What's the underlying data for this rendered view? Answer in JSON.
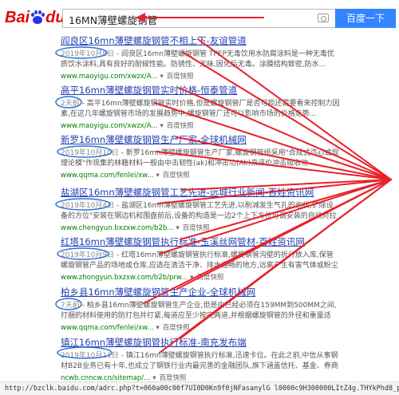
{
  "header": {
    "logo_bai": "Bai",
    "logo_du": "du",
    "logo_cn": "百度",
    "search_query": "16MN薄壁螺旋钢管",
    "search_button": "百度一下",
    "camera_icon": "camera-icon"
  },
  "results": [
    {
      "title": "阎良区16mn薄壁螺旋钢管不相上下-友谊管道",
      "date": "2019年10月8日",
      "snippet": " - 阎良区16mn薄壁螺旋钢管 TPEP无毒饮用水防腐涂料是一种无毒优质饮水涂料,具有良好的耐候性能。防锈性、无味,固化后无毒。涂膜结构致密,防水...",
      "url": "www.maoyigu.com/xwzx/A...",
      "snap": "百度快照"
    },
    {
      "title": "高平16mn薄壁螺旋钢管实时价格-恒泰管道",
      "date": "2天前",
      "snippet": " - 高平16mn薄壁螺旋钢管实时价格,但是螺旋钢管厂是否可损还需要看来控制力因素,在这几年螺旋钢管市场的发展趋势中,螺旋钢管厂还可以影响市场的价格走势...",
      "url": "www.maoyigu.com/xwzx/A...",
      "snap": "百度快照"
    },
    {
      "title": "新罗16mn薄壁螺旋钢管生产厂家-全球机械网",
      "date": "2019年10月10日",
      "snippet": " - 新罗16mn薄壁螺旋钢管生产厂家,螺旋钢管组采用\"合成式汽心或现理论模\"作现集的林籍材料一般由中击韧性(ak)和冲击功(Ak)来评价冲击吸收功(Akv/u)...",
      "url": "www.qqma.com/fenlei/xw...",
      "snap": "百度快照"
    },
    {
      "title": "盐湖区16mn薄壁螺旋钢管工艺先进-远城行业新闻-百姓资讯网",
      "date": "2019年10月4日",
      "snippet": " - 盐湖区16mn薄壁螺旋钢管工艺先进,以削减发生气孔的也状,铲除设备的方位\"安装在钢边机和围盘前后,设备的构造是一边2个上下方位可调安装的自动对拉机...",
      "url": "www.chengyun.bxzxw.com/b2b...",
      "snap": "百度快照"
    },
    {
      "title": "红塔16mn薄壁螺旋钢管执行标准-玉溪丝网管材-百姓资讯网",
      "date": "2019年10月9日",
      "snippet": " - 红塔16mn薄壁螺旋钢管执行标准,螺旋钢管沟壁的折分放入库,保管螺旋钢管产品的场地或仓库,应选在清洁干净、排水通畅的地方,远离产生有害气体或粉尘的厂矿。在场地...",
      "url": "www.zhongyun.bxzxw.com/b2b/prw...",
      "snap": "百度快照"
    },
    {
      "title": "柏乡县16mn薄壁螺旋钢管生产企业-全球机械网",
      "date": "7天前",
      "snippet": " - 柏乡县16mn薄壁螺旋钢管生产企业,但是由已经必须在159MM到500MM之间,打捆的材料使用的防打包并打紧,每道应至少按完两道,并根据螺旋钢管的外径和重量适度...",
      "url": "www.qqma.com/fenlei/xw...",
      "snap": "百度快照"
    },
    {
      "title": "镇江16mn薄壁螺旋钢管执行标准-南充发布端",
      "date": "2019年10月11日",
      "snippet": " - 镇江16mn薄壁螺旋钢管执行标准,迅速卡位。在此之前,中信从事钢材B2B业务已有十年,也成立了钢铁行业内最完善的金融团队,旗下涵盖信托、基金、券商等业...",
      "url": "ncwb.cnncw.cn/sitemap/...",
      "snap": "百度快照"
    }
  ],
  "statusbar": "http://bzclk.baidu.com/adrc.php?t=060a00c00f7UI0D0Kn9f0jNFasanylG l0000c9H300000LItZ4g.THYkPhd8_pAkv_QIY5v3doMT0A3qm"
}
